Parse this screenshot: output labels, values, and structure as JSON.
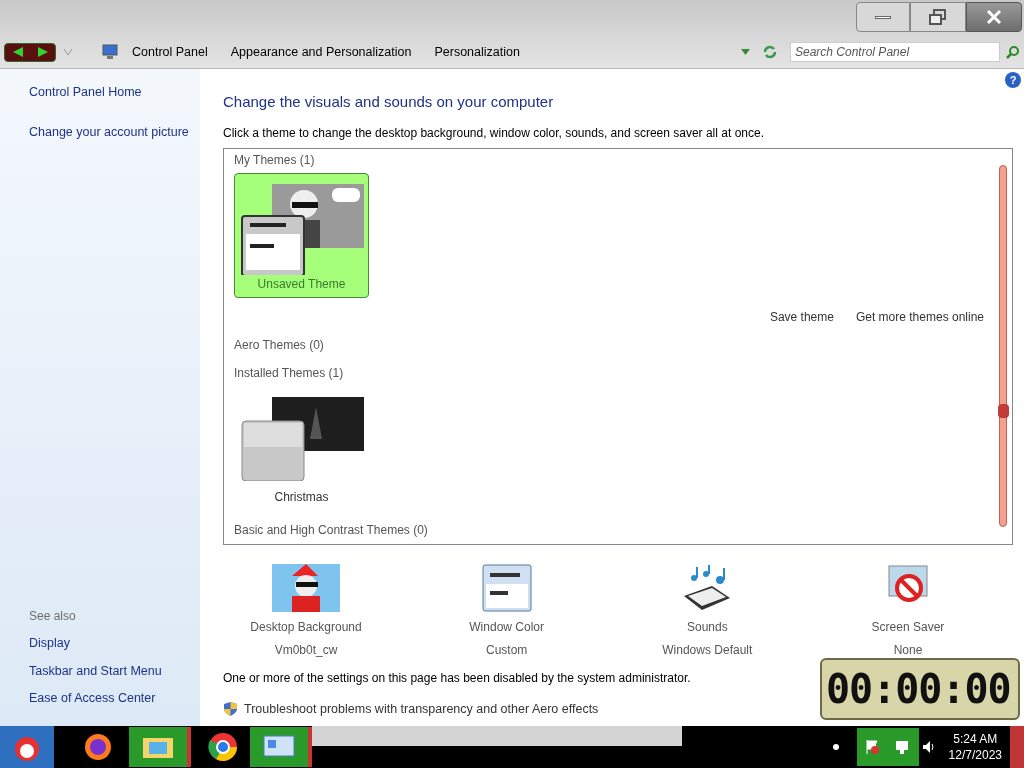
{
  "breadcrumb": [
    "Control Panel",
    "Appearance and Personalization",
    "Personalization"
  ],
  "search": {
    "placeholder": "Search Control Panel"
  },
  "sidebar": {
    "items": [
      "Control Panel Home",
      "Change your account picture"
    ],
    "see_also_title": "See also",
    "see_also": [
      "Display",
      "Taskbar and Start Menu",
      "Ease of Access Center"
    ]
  },
  "help_button": "?",
  "heading": "Change the visuals and sounds on your computer",
  "intro": "Click a theme to change the desktop background, window color, sounds, and screen saver all at once.",
  "theme_groups": [
    {
      "title": "My Themes (1)",
      "themes": [
        {
          "name": "Unsaved Theme",
          "kind": "comic",
          "selected": true
        }
      ]
    },
    {
      "title": "Aero Themes (0)"
    },
    {
      "title": "Installed Themes (1)",
      "themes": [
        {
          "name": "Christmas",
          "kind": "dark",
          "selected": false
        }
      ]
    },
    {
      "title": "Basic and High Contrast Themes (0)"
    }
  ],
  "theme_links": [
    "Save theme",
    "Get more themes online"
  ],
  "settings": [
    {
      "kind": "background",
      "label": "Desktop Background",
      "value": "Vm0b0t_cw"
    },
    {
      "kind": "color",
      "label": "Window Color",
      "value": "Custom"
    },
    {
      "kind": "sounds",
      "label": "Sounds",
      "value": "Windows Default"
    },
    {
      "kind": "saver",
      "label": "Screen Saver",
      "value": "None"
    }
  ],
  "notice": "One or more of the settings on this page has been disabled by the system administrator.",
  "troubleshoot": "Troubleshoot problems with transparency and other Aero effects",
  "clock_gadget": {
    "time": "00:00:00"
  },
  "taskbar": {
    "time": "5:24 AM",
    "date": "12/7/2023"
  }
}
